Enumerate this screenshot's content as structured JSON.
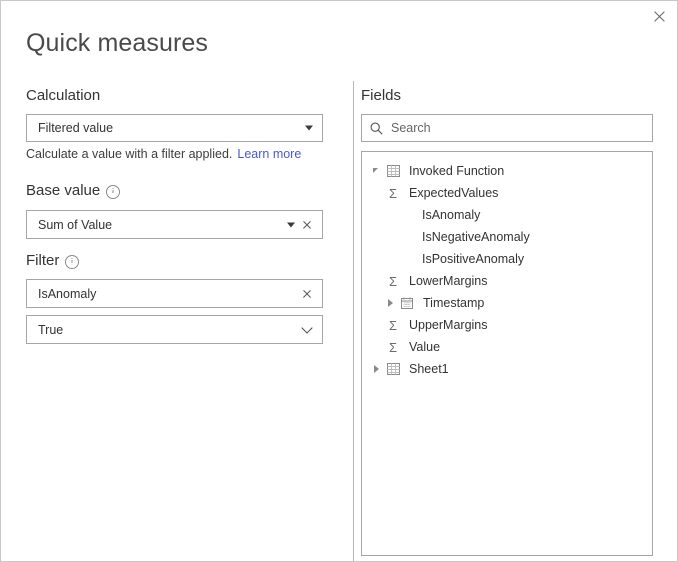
{
  "dialog": {
    "title": "Quick measures",
    "close_label": "Close"
  },
  "left": {
    "calculation": {
      "heading": "Calculation",
      "selected": "Filtered value",
      "help_text": "Calculate a value with a filter applied.",
      "help_link": "Learn more"
    },
    "base_value": {
      "heading": "Base value",
      "value": "Sum of Value"
    },
    "filter": {
      "heading": "Filter",
      "field_value": "IsAnomaly",
      "condition_value": "True"
    }
  },
  "right": {
    "heading": "Fields",
    "search": {
      "value": "",
      "placeholder": "Search"
    },
    "tree": [
      {
        "label": "Invoked Function",
        "icon": "grid-icon",
        "toggle": "expanded",
        "level": "table"
      },
      {
        "label": "ExpectedValues",
        "icon": "sigma-icon",
        "toggle": "none",
        "level": "field"
      },
      {
        "label": "IsAnomaly",
        "icon": "none",
        "toggle": "none",
        "level": "field-noicon"
      },
      {
        "label": "IsNegativeAnomaly",
        "icon": "none",
        "toggle": "none",
        "level": "field-noicon"
      },
      {
        "label": "IsPositiveAnomaly",
        "icon": "none",
        "toggle": "none",
        "level": "field-noicon"
      },
      {
        "label": "LowerMargins",
        "icon": "sigma-icon",
        "toggle": "none",
        "level": "field"
      },
      {
        "label": "Timestamp",
        "icon": "calendar-icon",
        "toggle": "collapsed",
        "level": "field"
      },
      {
        "label": "UpperMargins",
        "icon": "sigma-icon",
        "toggle": "none",
        "level": "field"
      },
      {
        "label": "Value",
        "icon": "sigma-icon",
        "toggle": "none",
        "level": "field"
      },
      {
        "label": "Sheet1",
        "icon": "grid-icon",
        "toggle": "collapsed",
        "level": "table"
      }
    ]
  },
  "colors": {
    "link": "#4a59c9",
    "border": "#a6a6a6",
    "text": "#333333",
    "title": "#4a4a4a"
  }
}
